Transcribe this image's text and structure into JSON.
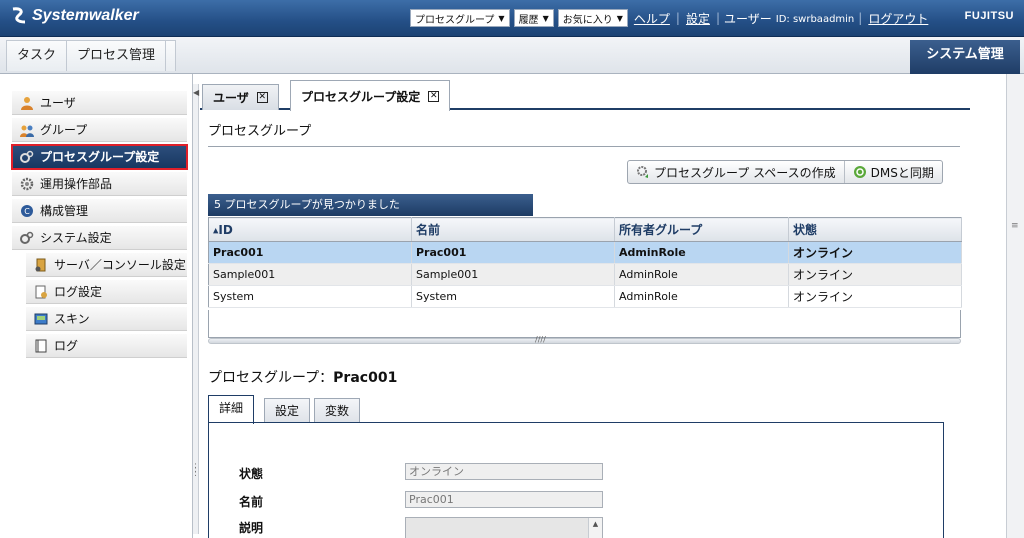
{
  "header": {
    "logo_text": "Systemwalker",
    "menus": [
      {
        "label": "プロセスグループ"
      },
      {
        "label": "履歴"
      },
      {
        "label": "お気に入り"
      }
    ],
    "help_label": "ヘルプ",
    "settings_label": "設定",
    "user_label": "ユーザー",
    "user_id_label": "ID: swrbaadmin",
    "logout_label": "ログアウト",
    "brand": "FUJITSU"
  },
  "menubar": {
    "items": [
      {
        "label": "タスク"
      },
      {
        "label": "プロセス管理"
      }
    ],
    "active_section": "システム管理"
  },
  "sidebar": {
    "items": [
      {
        "label": "ユーザ",
        "icon": "user-icon"
      },
      {
        "label": "グループ",
        "icon": "group-icon"
      },
      {
        "label": "プロセスグループ設定",
        "icon": "gears-icon",
        "selected": true
      },
      {
        "label": "運用操作部品",
        "icon": "gear-icon"
      },
      {
        "label": "構成管理",
        "icon": "config-icon"
      },
      {
        "label": "システム設定",
        "icon": "gears-icon"
      },
      {
        "label": "サーバ／コンソール設定",
        "icon": "server-console-icon"
      },
      {
        "label": "ログ設定",
        "icon": "log-settings-icon"
      },
      {
        "label": "スキン",
        "icon": "skin-icon"
      },
      {
        "label": "ログ",
        "icon": "log-icon"
      }
    ]
  },
  "tabs": [
    {
      "label": "ユーザ"
    },
    {
      "label": "プロセスグループ設定",
      "active": true
    }
  ],
  "section_title": "プロセスグループ",
  "actions": {
    "create_space": "プロセスグループ スペースの作成",
    "sync_dms": "DMSと同期"
  },
  "grid": {
    "found_text": "5 プロセスグループが見つかりました",
    "sort_indicator": "▲",
    "columns": [
      "ID",
      "名前",
      "所有者グループ",
      "状態"
    ],
    "rows": [
      {
        "id": "Prac001",
        "name": "Prac001",
        "owner": "AdminRole",
        "state": "オンライン"
      },
      {
        "id": "Sample001",
        "name": "Sample001",
        "owner": "AdminRole",
        "state": "オンライン"
      },
      {
        "id": "System",
        "name": "System",
        "owner": "AdminRole",
        "state": "オンライン"
      }
    ]
  },
  "detail": {
    "title_prefix": "プロセスグループ：",
    "title_value": "Prac001",
    "tabs": [
      {
        "label": "詳細"
      },
      {
        "label": "設定"
      },
      {
        "label": "変数"
      }
    ],
    "fields": {
      "state_label": "状態",
      "state_value": "オンライン",
      "name_label": "名前",
      "name_value": "Prac001",
      "desc_label": "説明",
      "desc_value": ""
    }
  },
  "colors": {
    "header_bg": "#244f86",
    "accent_navy": "#1f3d66",
    "selected_row": "#b9d6f2",
    "active_outline": "#e0202a"
  }
}
